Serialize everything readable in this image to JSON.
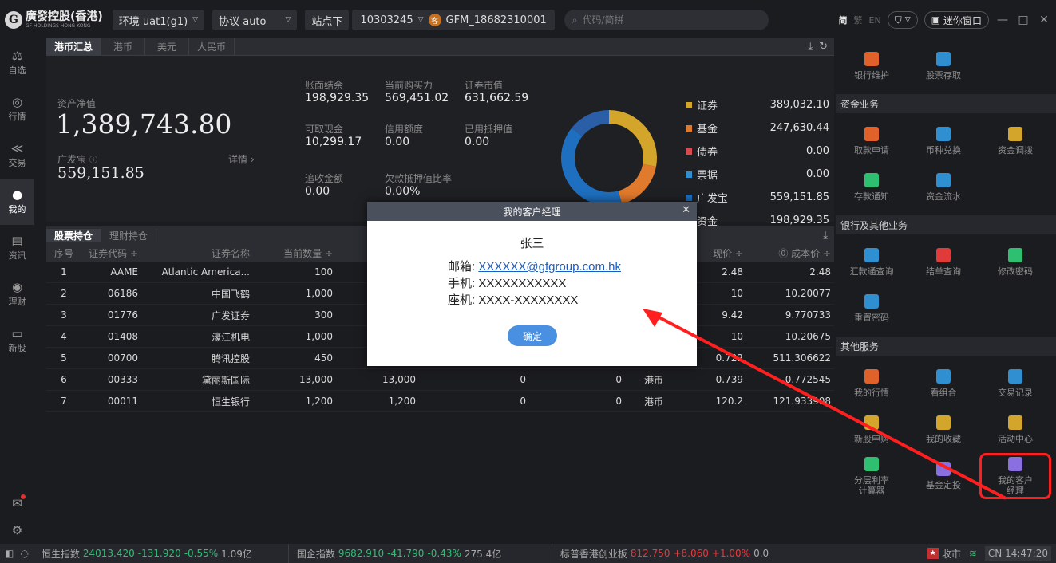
{
  "topbar": {
    "logo_cn": "廣發控股(香港)",
    "logo_en": "GF HOLDINGS HONG KONG",
    "env_label": "环境 uat1(g1)",
    "protocol_label": "协议 auto",
    "site_label": "站点下",
    "account_no": "10303245",
    "account_user": "GFM_18682310001",
    "search_placeholder": "代码/简拼",
    "lang_simplified": "简",
    "lang_traditional": "繁",
    "lang_en": "EN",
    "mini_window_label": "迷你窗口"
  },
  "leftnav": {
    "items": [
      {
        "label": "自选"
      },
      {
        "label": "行情"
      },
      {
        "label": "交易"
      },
      {
        "label": "我的"
      },
      {
        "label": "资讯"
      },
      {
        "label": "理财"
      },
      {
        "label": "新股"
      }
    ]
  },
  "currency_tabs": [
    "港币汇总",
    "港币",
    "美元",
    "人民币"
  ],
  "summary": {
    "net_asset_label": "资产净值",
    "net_asset_value": "1,389,743.80",
    "gfb_label": "广发宝",
    "gfb_value": "559,151.85",
    "detail_label": "详情 ›",
    "fields": [
      {
        "label": "账面结余",
        "value": "198,929.35"
      },
      {
        "label": "当前购买力",
        "value": "569,451.02"
      },
      {
        "label": "证券市值",
        "value": "631,662.59"
      },
      {
        "label": "可取现金",
        "value": "10,299.17"
      },
      {
        "label": "信用额度",
        "value": "0.00"
      },
      {
        "label": "已用抵押值",
        "value": "0.00"
      },
      {
        "label": "追收金额",
        "value": "0.00"
      },
      {
        "label": "欠款抵押值比率",
        "value": "0.00%"
      }
    ]
  },
  "allocation": {
    "items": [
      {
        "name": "证券",
        "value": "389,032.10",
        "amount": 389032.1,
        "color": "#d4a52b"
      },
      {
        "name": "基金",
        "value": "247,630.44",
        "amount": 247630.44,
        "color": "#e07a2c"
      },
      {
        "name": "债券",
        "value": "0.00",
        "amount": 0,
        "color": "#d94a4a"
      },
      {
        "name": "票据",
        "value": "0.00",
        "amount": 0,
        "color": "#2f8fd0"
      },
      {
        "name": "广发宝",
        "value": "559,151.85",
        "amount": 559151.85,
        "color": "#1e6fbf"
      },
      {
        "name": "资金",
        "value": "198,929.35",
        "amount": 198929.35,
        "color": "#2a5fa8"
      }
    ]
  },
  "holdings_tabs": [
    "股票持仓",
    "理财持仓"
  ],
  "table": {
    "headers": [
      "序号",
      "证券代码 ÷",
      "证券名称",
      "当前数量 ÷",
      "",
      "",
      "",
      "",
      "现价 ÷",
      "⓪ 成本价 ÷"
    ],
    "rows": [
      [
        "1",
        "AAME",
        "Atlantic America...",
        "100",
        "",
        "",
        "",
        "",
        "2.48",
        "2.48"
      ],
      [
        "2",
        "06186",
        "中国飞鹤",
        "1,000",
        "",
        "",
        "",
        "",
        "10",
        "10.20077"
      ],
      [
        "3",
        "01776",
        "广发证券",
        "300",
        "",
        "",
        "",
        "",
        "9.42",
        "9.770733"
      ],
      [
        "4",
        "01408",
        "濠江机电",
        "1,000",
        "",
        "",
        "",
        "",
        "10",
        "10.20675"
      ],
      [
        "5",
        "00700",
        "腾讯控股",
        "450",
        "",
        "",
        "",
        "",
        "0.722",
        "511.306622"
      ],
      [
        "6",
        "00333",
        "黛丽斯国际",
        "13,000",
        "13,000",
        "0",
        "0",
        "港币",
        "0.739",
        "0.772545"
      ],
      [
        "7",
        "00011",
        "恒生银行",
        "1,200",
        "1,200",
        "0",
        "0",
        "港币",
        "120.2",
        "121.933908"
      ]
    ]
  },
  "rpanel": {
    "top_items": [
      {
        "label": "银行维护",
        "icon": "bank-card-icon",
        "color": "#e0622a"
      },
      {
        "label": "股票存取",
        "icon": "stock-chart-icon",
        "color": "#2f8fd0"
      }
    ],
    "fund_header": "资金业务",
    "fund_items": [
      {
        "label": "取款申请",
        "icon": "money-bag-icon",
        "color": "#e0622a"
      },
      {
        "label": "币种兑换",
        "icon": "exchange-icon",
        "color": "#2f8fd0"
      },
      {
        "label": "资金调拨",
        "icon": "wallet-icon",
        "color": "#d4a52b"
      },
      {
        "label": "存款通知",
        "icon": "deposit-icon",
        "color": "#2fbf71"
      },
      {
        "label": "资金流水",
        "icon": "flow-icon",
        "color": "#2f8fd0"
      }
    ],
    "bank_header": "银行及其他业务",
    "bank_items": [
      {
        "label": "汇款通查询",
        "icon": "person-icon",
        "color": "#2f8fd0"
      },
      {
        "label": "结单查询",
        "icon": "ticket-icon",
        "color": "#e03a3a"
      },
      {
        "label": "修改密码",
        "icon": "lock-icon",
        "color": "#2fbf71"
      },
      {
        "label": "重置密码",
        "icon": "reset-lock-icon",
        "color": "#2f8fd0"
      }
    ],
    "other_header": "其他服务",
    "other_items": [
      {
        "label": "我的行情",
        "icon": "quote-icon",
        "color": "#e0622a"
      },
      {
        "label": "看组合",
        "icon": "portfolio-icon",
        "color": "#2f8fd0"
      },
      {
        "label": "交易记录",
        "icon": "record-icon",
        "color": "#2f8fd0"
      },
      {
        "label": "新股申购",
        "icon": "ipo-icon",
        "color": "#d4a52b"
      },
      {
        "label": "我的收藏",
        "icon": "star-icon",
        "color": "#d4a52b"
      },
      {
        "label": "活动中心",
        "icon": "gift-icon",
        "color": "#d4a52b"
      },
      {
        "label": "分层利率计算器",
        "icon": "calculator-icon",
        "color": "#2fbf71"
      },
      {
        "label": "基金定投",
        "icon": "clock-icon",
        "color": "#8a6fe0"
      },
      {
        "label": "我的客户经理",
        "icon": "manager-icon",
        "color": "#8a6fe0"
      }
    ]
  },
  "statusbar": {
    "hsi_label": "恒生指数",
    "hsi_value": "24013.420",
    "hsi_change": "-131.920",
    "hsi_pct": "-0.55%",
    "hsi_turnover": "1.09亿",
    "hscei_label": "国企指数",
    "hscei_value": "9682.910",
    "hscei_change": "-41.790",
    "hscei_pct": "-0.43%",
    "hscei_turnover": "275.4亿",
    "gem_label": "标普香港创业板",
    "gem_value": "812.750",
    "gem_change": "+8.060",
    "gem_pct": "+1.00%",
    "gem_turnover": "0.0",
    "market_status": "收市",
    "clock": "CN 14:47:20"
  },
  "modal": {
    "title": "我的客户经理",
    "name": "张三",
    "email_label": "邮箱:",
    "email": "XXXXXX@gfgroup.com.hk",
    "phone_label": "手机:",
    "phone": "XXXXXXXXXXX",
    "landline_label": "座机:",
    "landline": "XXXX-XXXXXXXX",
    "ok_label": "确定"
  },
  "annotation": {
    "color": "#ff1f1f"
  }
}
